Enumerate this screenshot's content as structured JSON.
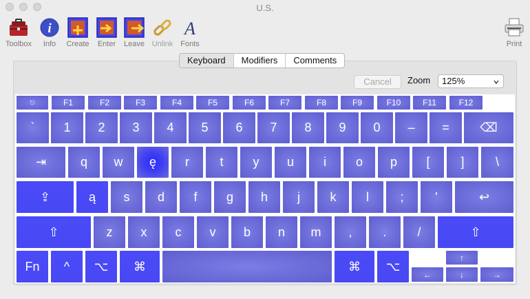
{
  "window": {
    "title": "U.S."
  },
  "toolbar": {
    "toolbox": "Toolbox",
    "info": "Info",
    "create": "Create",
    "enter": "Enter",
    "leave": "Leave",
    "unlink": "Unlink",
    "fonts": "Fonts",
    "print": "Print"
  },
  "tabs": [
    "Keyboard",
    "Modifiers",
    "Comments"
  ],
  "active_tab": "Keyboard",
  "controls": {
    "cancel": "Cancel",
    "zoom_label": "Zoom",
    "zoom_value": "125%"
  },
  "colors": {
    "key": "#6a6ad8",
    "key_highlight": "#2a2aff",
    "key_modifier": "#4848f4"
  },
  "keys": {
    "esc": "⎋",
    "f1": "F1",
    "f2": "F2",
    "f3": "F3",
    "f4": "F4",
    "f5": "F5",
    "f6": "F6",
    "f7": "F7",
    "f8": "F8",
    "f9": "F9",
    "f10": "F10",
    "f11": "F11",
    "f12": "F12",
    "grave": "`",
    "n1": "1",
    "n2": "2",
    "n3": "3",
    "n4": "4",
    "n5": "5",
    "n6": "6",
    "n7": "7",
    "n8": "8",
    "n9": "9",
    "n0": "0",
    "minus": "–",
    "equal": "=",
    "delete": "⌫",
    "tab": "⇥",
    "q": "q",
    "w": "w",
    "e": "ę",
    "r": "r",
    "t": "t",
    "y": "y",
    "u": "u",
    "i": "i",
    "o": "o",
    "p": "p",
    "lbracket": "[",
    "rbracket": "]",
    "backslash": "\\",
    "capslock": "⇪",
    "a": "ą",
    "s": "s",
    "d": "d",
    "f": "f",
    "g": "g",
    "h": "h",
    "j": "j",
    "k": "k",
    "l": "l",
    "semicolon": ";",
    "quote": "'",
    "return": "↩",
    "lshift": "⇧",
    "z": "z",
    "x": "x",
    "c": "c",
    "v": "v",
    "b": "b",
    "n": "n",
    "m": "m",
    "comma": ",",
    "period": ".",
    "slash": "/",
    "rshift": "⇧",
    "fn": "Fn",
    "control": "^",
    "loption": "⌥",
    "lcommand": "⌘",
    "space": "",
    "rcommand": "⌘",
    "roption": "⌥",
    "up": "↑",
    "left": "←",
    "down": "↓",
    "right": "→"
  }
}
